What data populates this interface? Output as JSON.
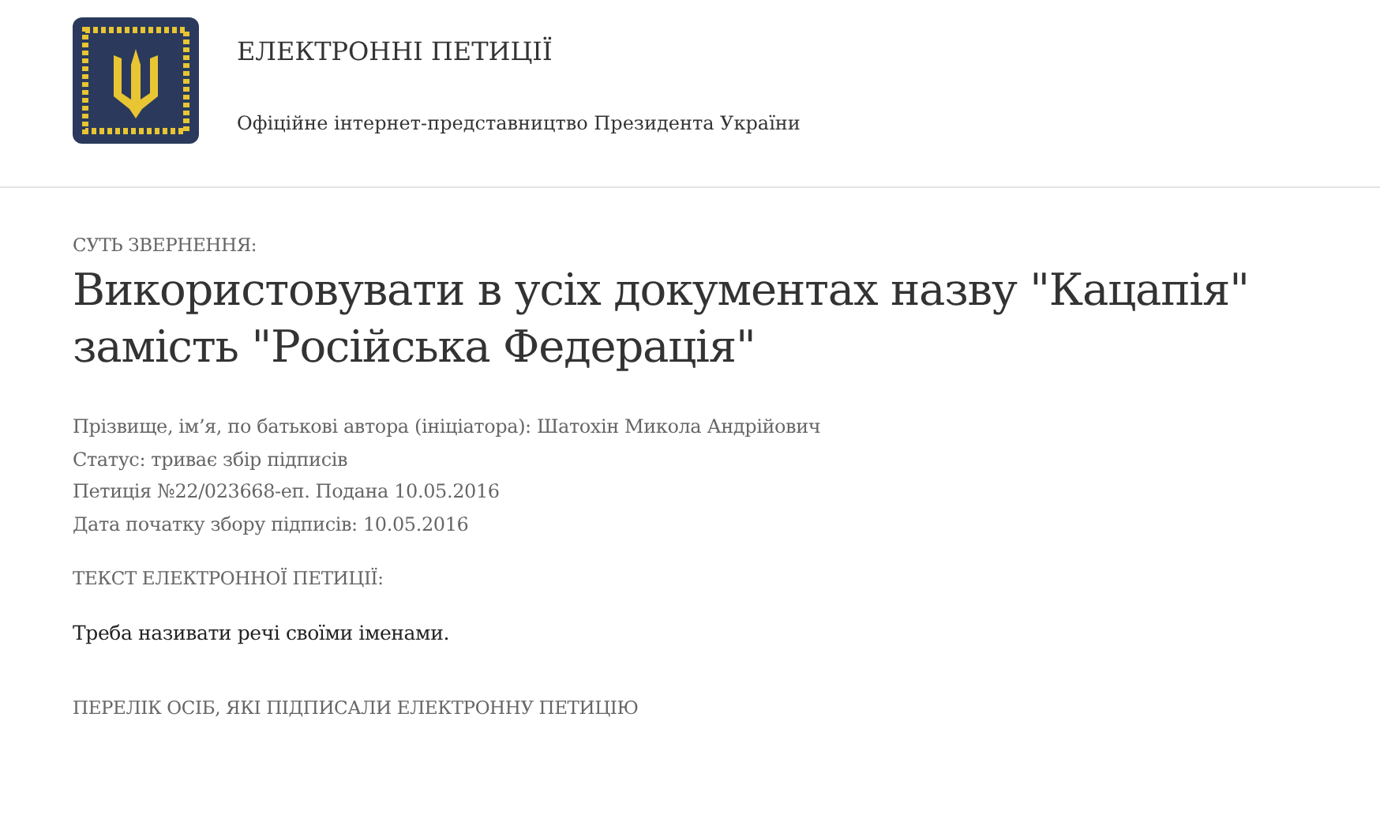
{
  "header": {
    "title": "ЕЛЕКТРОННІ ПЕТИЦІЇ",
    "subtitle": "Офіційне інтернет-представництво Президента України"
  },
  "petition": {
    "subject_label": "СУТЬ ЗВЕРНЕННЯ:",
    "title": "Використовувати в усіх документах назву \"Кацапія\" замість \"Російська Федерація\"",
    "details": [
      "Прізвище, ім’я, по батькові автора (ініціатора): Шатохін Микола Андрійович",
      "Статус: триває збір підписів",
      "Петиція №22/023668-еп. Подана 10.05.2016",
      "Дата початку збору підписів: 10.05.2016"
    ],
    "text_label": "ТЕКСТ ЕЛЕКТРОННОЇ ПЕТИЦІЇ:",
    "text": "Треба називати речі своїми іменами.",
    "signers_label": "ПЕРЕЛІК ОСІБ, ЯКІ ПІДПИСАЛИ ЕЛЕКТРОННУ ПЕТИЦІЮ"
  }
}
